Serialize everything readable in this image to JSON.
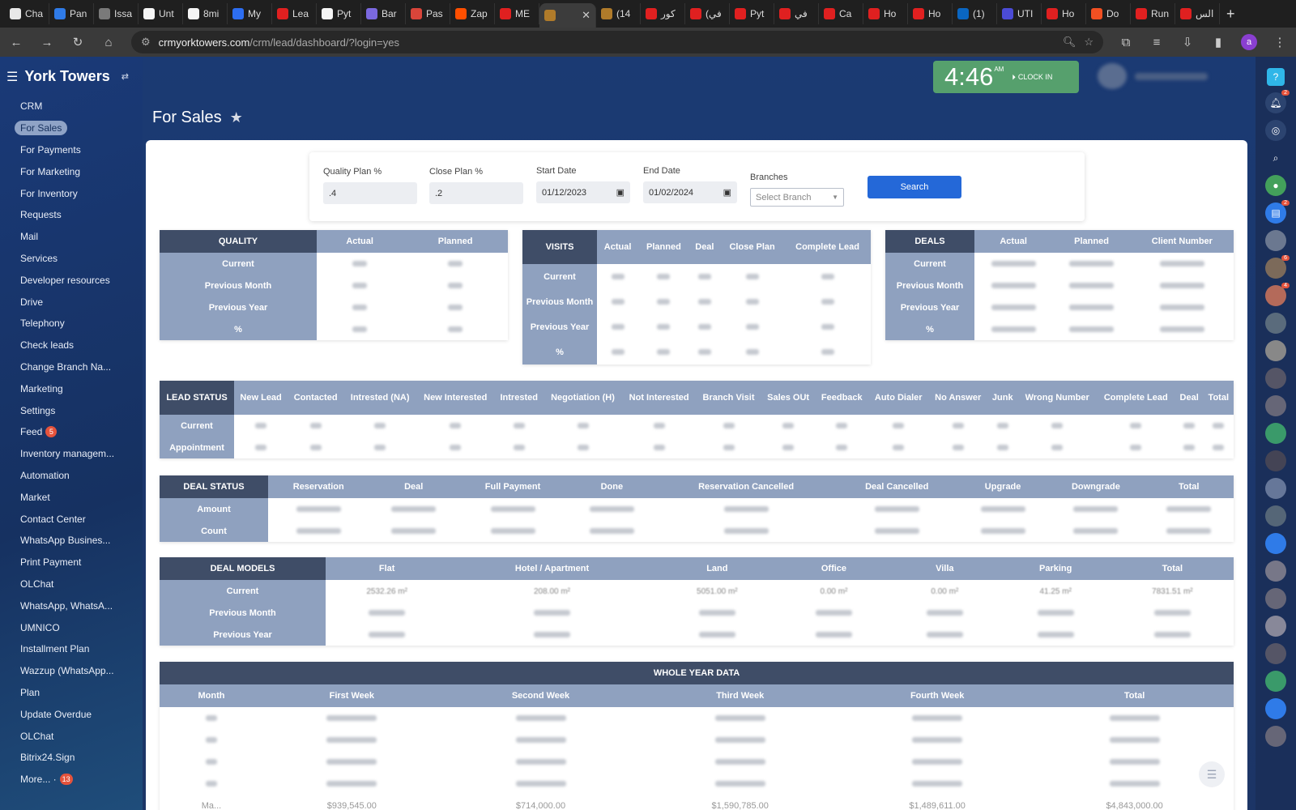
{
  "browser": {
    "tabs": [
      {
        "label": "Cha",
        "color": "#e8e8e8"
      },
      {
        "label": "Pan",
        "color": "#2f7be8"
      },
      {
        "label": "Issa",
        "color": "#7a7a7a"
      },
      {
        "label": "Unt",
        "color": "#f5f5f5"
      },
      {
        "label": "8mi",
        "color": "#f5f5f5"
      },
      {
        "label": "My",
        "color": "#2d6ef2"
      },
      {
        "label": "Lea",
        "color": "#e02020"
      },
      {
        "label": "Pyt",
        "color": "#f5f5f5"
      },
      {
        "label": "Bar",
        "color": "#7b69e0"
      },
      {
        "label": "Pas",
        "color": "#d9453a"
      },
      {
        "label": "Zap",
        "color": "#ff4f00"
      },
      {
        "label": "ME",
        "color": "#e02020"
      },
      {
        "label": "",
        "color": "#b07b2a",
        "active": true
      },
      {
        "label": "(14",
        "color": "#b07b2a"
      },
      {
        "label": "كور",
        "color": "#e02020"
      },
      {
        "label": "(في",
        "color": "#e02020"
      },
      {
        "label": "Pyt",
        "color": "#e02020"
      },
      {
        "label": "في",
        "color": "#e02020"
      },
      {
        "label": "Ca",
        "color": "#e02020"
      },
      {
        "label": "Ho",
        "color": "#e02020"
      },
      {
        "label": "Ho",
        "color": "#e02020"
      },
      {
        "label": "(1)",
        "color": "#0a66c2"
      },
      {
        "label": "UTI",
        "color": "#4b4bd6"
      },
      {
        "label": "Ho",
        "color": "#e02020"
      },
      {
        "label": "Do",
        "color": "#f25022"
      },
      {
        "label": "Run",
        "color": "#e02020"
      },
      {
        "label": "الس",
        "color": "#e02020"
      }
    ],
    "url_host": "crmyorktowers.com",
    "url_path": "/crm/lead/dashboard/?login=yes",
    "profile_letter": "a"
  },
  "app": {
    "brand": "York Towers",
    "page_title": "For Sales",
    "clock": {
      "time": "4:46",
      "ampm": "AM",
      "clock_in": "CLOCK IN"
    },
    "menu": [
      {
        "label": "CRM"
      },
      {
        "label": "For Sales",
        "active": true
      },
      {
        "label": "For Payments"
      },
      {
        "label": "For Marketing"
      },
      {
        "label": "For Inventory"
      },
      {
        "label": "Requests"
      },
      {
        "label": "Mail"
      },
      {
        "label": "Services"
      },
      {
        "label": "Developer resources"
      },
      {
        "label": "Drive"
      },
      {
        "label": "Telephony"
      },
      {
        "label": "Check leads"
      },
      {
        "label": "Change Branch Na..."
      },
      {
        "label": "Marketing"
      },
      {
        "label": "Settings"
      },
      {
        "label": "Feed",
        "badge": "5"
      },
      {
        "label": "Inventory managem..."
      },
      {
        "label": "Automation"
      },
      {
        "label": "Market"
      },
      {
        "label": "Contact Center"
      },
      {
        "label": "WhatsApp Busines..."
      },
      {
        "label": "Print Payment"
      },
      {
        "label": "OLChat"
      },
      {
        "label": "WhatsApp, WhatsA..."
      },
      {
        "label": "UMNICO"
      },
      {
        "label": "Installment Plan"
      },
      {
        "label": "Wazzup (WhatsApp..."
      },
      {
        "label": "Plan"
      },
      {
        "label": "Update Overdue"
      },
      {
        "label": "OLChat"
      },
      {
        "label": "Bitrix24.Sign"
      },
      {
        "label": "More... ·",
        "badge": "13"
      }
    ],
    "right_badges": {
      "notifications": "2",
      "chat": "2",
      "a3": "6",
      "a4": "4"
    }
  },
  "filters": {
    "quality_plan_label": "Quality Plan %",
    "quality_plan_value": ".4",
    "close_plan_label": "Close Plan %",
    "close_plan_value": ".2",
    "start_date_label": "Start Date",
    "start_date_value": "01/12/2023",
    "end_date_label": "End Date",
    "end_date_value": "01/02/2024",
    "branches_label": "Branches",
    "branches_placeholder": "Select Branch",
    "search_label": "Search"
  },
  "quality": {
    "title": "QUALITY",
    "cols": [
      "Actual",
      "Planned"
    ],
    "rows": [
      "Current",
      "Previous Month",
      "Previous Year",
      "%"
    ]
  },
  "visits": {
    "title": "VISITS",
    "cols": [
      "Actual",
      "Planned",
      "Deal",
      "Close Plan",
      "Complete Lead"
    ],
    "rows": [
      "Current",
      "Previous Month",
      "Previous Year",
      "%"
    ]
  },
  "deals": {
    "title": "DEALS",
    "cols": [
      "Actual",
      "Planned",
      "Client Number"
    ],
    "rows": [
      "Current",
      "Previous Month",
      "Previous Year",
      "%"
    ]
  },
  "lead_status": {
    "title": "LEAD STATUS",
    "cols": [
      "New Lead",
      "Contacted",
      "Intrested (NA)",
      "New Interested",
      "Intrested",
      "Negotiation (H)",
      "Not Interested",
      "Branch Visit",
      "Sales OUt",
      "Feedback",
      "Auto Dialer",
      "No Answer",
      "Junk",
      "Wrong Number",
      "Complete Lead",
      "Deal",
      "Total"
    ],
    "rows": [
      "Current",
      "Appointment"
    ]
  },
  "deal_status": {
    "title": "DEAL STATUS",
    "cols": [
      "Reservation",
      "Deal",
      "Full Payment",
      "Done",
      "Reservation Cancelled",
      "Deal Cancelled",
      "Upgrade",
      "Downgrade",
      "Total"
    ],
    "rows": [
      "Amount",
      "Count"
    ]
  },
  "deal_models": {
    "title": "DEAL MODELS",
    "cols": [
      "Flat",
      "Hotel / Apartment",
      "Land",
      "Office",
      "Villa",
      "Parking",
      "Total"
    ],
    "rows": [
      "Current",
      "Previous Month",
      "Previous Year"
    ],
    "current_values": [
      "2532.26 m²",
      "208.00 m²",
      "5051.00 m²",
      "0.00 m²",
      "0.00 m²",
      "41.25 m²",
      "7831.51 m²"
    ]
  },
  "whole_year": {
    "title": "WHOLE YEAR DATA",
    "cols": [
      "Month",
      "First Week",
      "Second Week",
      "Third Week",
      "Fourth Week",
      "Total"
    ],
    "last_row": [
      "Ma...",
      "$939,545.00",
      "$714,000.00",
      "$1,590,785.00",
      "$1,489,611.00",
      "$4,843,000.00"
    ]
  }
}
